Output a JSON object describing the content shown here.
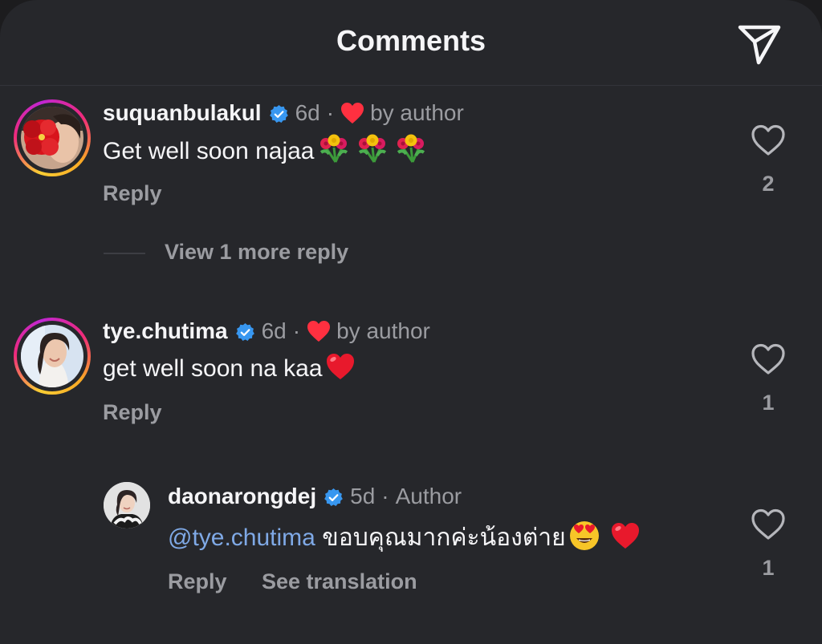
{
  "header": {
    "title": "Comments",
    "share_icon": "paper-plane-icon"
  },
  "colors": {
    "background": "#26272b",
    "primary_text": "#f5f5f7",
    "secondary_text": "#9b9ca1",
    "mention": "#7fa9e6",
    "verified_badge": "#3897f0",
    "like_red": "#ff3040"
  },
  "comments": [
    {
      "username": "suquanbulakul",
      "verified": true,
      "age": "6d",
      "liked_by_author_label": "by author",
      "text": "Get well soon najaa",
      "emojis": [
        "bouquet-emoji",
        "bouquet-emoji",
        "bouquet-emoji"
      ],
      "reply_label": "Reply",
      "like_count": "2",
      "more_replies_label": "View 1 more reply"
    },
    {
      "username": "tye.chutima",
      "verified": true,
      "age": "6d",
      "liked_by_author_label": "by author",
      "text": "get well soon na kaa",
      "emojis": [
        "red-heart-emoji"
      ],
      "reply_label": "Reply",
      "like_count": "1",
      "replies": [
        {
          "username": "daonarongdej",
          "verified": true,
          "age": "5d",
          "author_label": "Author",
          "mention": "@tye.chutima",
          "text": "ขอบคุณมากค่ะน้องต่าย",
          "emojis": [
            "heart-eyes-emoji",
            "red-heart-emoji"
          ],
          "reply_label": "Reply",
          "translate_label": "See translation",
          "like_count": "1"
        }
      ]
    }
  ]
}
